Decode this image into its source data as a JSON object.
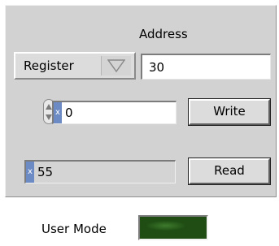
{
  "address": {
    "label": "Address",
    "value": "30"
  },
  "register_ring": {
    "selected": "Register"
  },
  "write": {
    "radix": "x",
    "value": "0",
    "button_label": "Write"
  },
  "read": {
    "radix": "x",
    "value": "55",
    "button_label": "Read"
  },
  "user_mode": {
    "label": "User Mode",
    "led_color": "#1f4d14",
    "led_on": false
  },
  "colors": {
    "panel": "#d2d2d2",
    "radix_marker": "#6c8bc4"
  }
}
